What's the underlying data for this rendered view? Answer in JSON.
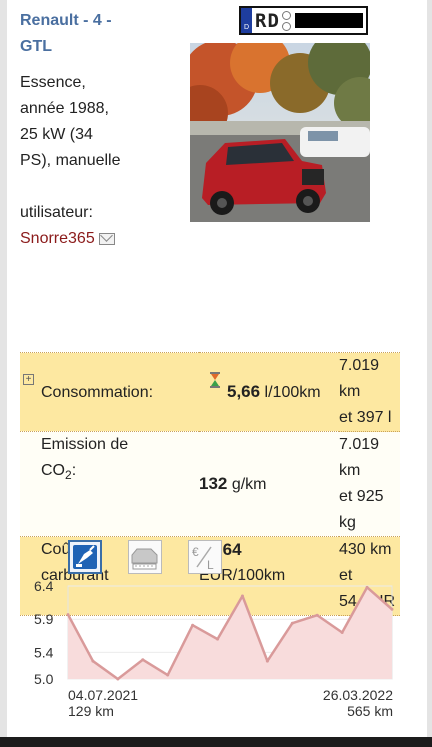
{
  "vehicle": {
    "title_line1": "Renault - 4 -",
    "title_line2": "GTL",
    "desc_line1": "Essence,",
    "desc_line2": "année 1988,",
    "desc_line3": "25 kW (34",
    "desc_line4": "PS), manuelle",
    "user_label": "utilisateur:",
    "user_name": "Snorre365"
  },
  "plate": {
    "eu_letter": "D",
    "code": "RD"
  },
  "stats": {
    "consumption": {
      "label": "Consommation:",
      "value": "5,66",
      "unit": "l/100km",
      "total_line1": "7.019 km",
      "total_line2": "et 397 l"
    },
    "emission": {
      "label_line1": "Emission de",
      "label_line2": "CO",
      "label_sub": "2",
      "label_colon": ":",
      "value": "132",
      "unit": "g/km",
      "total_line1": "7.019 km",
      "total_line2": "et 925 kg"
    },
    "cost": {
      "label_line1": "Coût en",
      "label_line2": "carburant",
      "value": "12,64",
      "unit": "EUR/100km",
      "total_line1": "430 km et",
      "total_line2": "54 EUR"
    }
  },
  "tabs": {
    "active": "fuel",
    "items": [
      "fuel-consumption-tab",
      "car-tab",
      "cost-per-liter-tab"
    ],
    "cost_symbol": "€/L"
  },
  "chart_data": {
    "type": "area",
    "y_ticks": [
      "6.4",
      "5.9",
      "5.4",
      "5.0"
    ],
    "y_tick_values": [
      6.4,
      5.9,
      5.4,
      5.0
    ],
    "ylim": [
      5.0,
      6.4
    ],
    "start_date": "04.07.2021",
    "start_km": "129 km",
    "end_date": "26.03.2022",
    "end_km": "565 km",
    "values": [
      5.97,
      5.27,
      5.0,
      5.29,
      5.06,
      5.81,
      5.6,
      6.25,
      5.27,
      5.84,
      5.96,
      5.7,
      6.38,
      6.05
    ],
    "line_color": "#d99a9a",
    "fill_color": "#f8dcdc",
    "grid": true
  }
}
